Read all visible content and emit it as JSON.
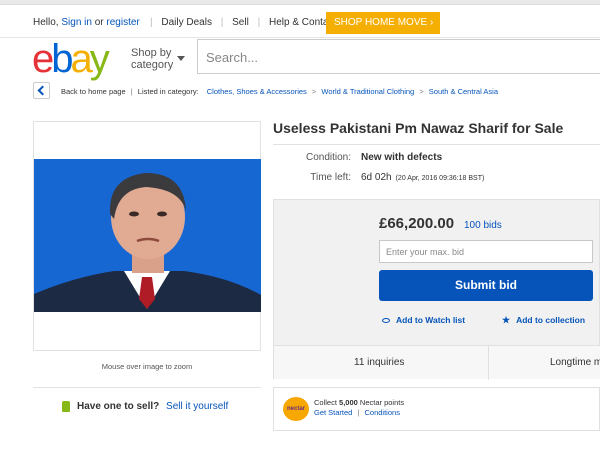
{
  "topbar": {
    "greeting_prefix": "Hello,",
    "sign_in": "Sign in",
    "or": "or",
    "register": "register",
    "links": [
      "Daily Deals",
      "Sell",
      "Help & Contact"
    ],
    "promo": "SHOP HOME MOVE ›"
  },
  "header": {
    "logo_letters": [
      "e",
      "b",
      "a",
      "y"
    ],
    "shop_by_line1": "Shop by",
    "shop_by_line2": "category",
    "search_placeholder": "Search..."
  },
  "breadcrumb": {
    "back": "Back to home page",
    "listed_in": "Listed in category:",
    "items": [
      "Clothes, Shoes & Accessories",
      "World & Traditional Clothing",
      "South & Central Asia"
    ]
  },
  "gallery": {
    "photo_alt": "Listing photo",
    "zoom_hint": "Mouse over image to zoom"
  },
  "sell": {
    "question": "Have one to sell?",
    "link": "Sell it yourself"
  },
  "item": {
    "title": "Useless Pakistani Pm Nawaz Sharif for Sale",
    "condition_label": "Condition:",
    "condition_value": "New with defects",
    "time_left_label": "Time left:",
    "time_left_value": "6d 02h",
    "time_left_detail": "(20 Apr, 2016   09:36:18 BST)"
  },
  "bidding": {
    "price": "£66,200.00",
    "bids": "100 bids",
    "max_bid_placeholder": "Enter your max. bid",
    "submit_label": "Submit bid",
    "watch_label": "Add to Watch list",
    "collection_label": "Add to collection",
    "inquiries": "11 inquiries",
    "longtime": "Longtime m"
  },
  "nectar": {
    "logo_text": "nectar",
    "collect_prefix": "Collect",
    "points": "5,000",
    "points_suffix": "Nectar points",
    "get_started": "Get Started",
    "conditions": "Conditions"
  },
  "colors": {
    "link": "#0654ba",
    "promo": "#f5af02",
    "submit": "#0654ba",
    "photo_bg": "#1767d3"
  }
}
